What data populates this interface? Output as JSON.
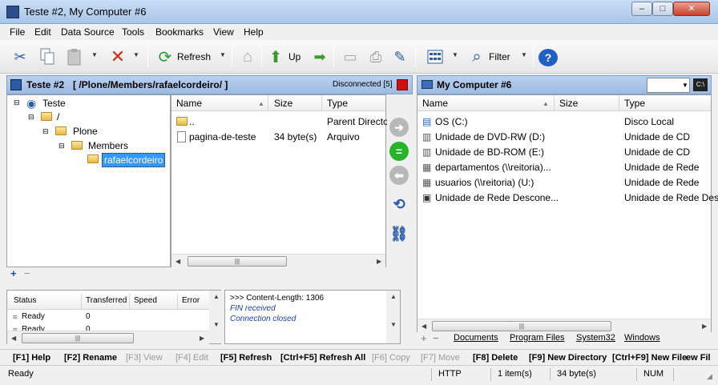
{
  "window": {
    "title": "Teste #2, My Computer #6",
    "min": "–",
    "max": "□",
    "close": "✕"
  },
  "menu": [
    "File",
    "Edit",
    "Data Source",
    "Tools",
    "Bookmarks",
    "View",
    "Help"
  ],
  "toolbar": {
    "refresh": "Refresh",
    "up": "Up",
    "filter": "Filter"
  },
  "left_panel": {
    "name": "Teste #2",
    "path": "[ /Plone/Members/rafaelcordeiro/ ]",
    "status": "Disconnected [5]",
    "tree": [
      "Teste",
      "/",
      "Plone",
      "Members",
      "rafaelcordeiro"
    ],
    "columns": [
      "Name",
      "Size",
      "Type"
    ],
    "files": [
      {
        "name": "..",
        "size": "",
        "type": "Parent Directo"
      },
      {
        "name": "pagina-de-teste",
        "size": "34 byte(s)",
        "type": "Arquivo"
      }
    ],
    "tree_add": "+",
    "tree_remove": "−"
  },
  "transfers": {
    "columns": [
      "Status",
      "Transferred",
      "Speed",
      "Error"
    ],
    "rows": [
      {
        "status": "Ready",
        "transferred": "0"
      },
      {
        "status": "Ready",
        "transferred": "0"
      }
    ]
  },
  "log": [
    "&gt;&gt;&gt; Content-Length: 1306",
    "FIN received",
    "Connection closed"
  ],
  "right_panel": {
    "name": "My Computer #6",
    "columns": [
      "Name",
      "Size",
      "Type"
    ],
    "files": [
      {
        "name": "OS (C:)",
        "type": "Disco Local"
      },
      {
        "name": "Unidade de DVD-RW (D:)",
        "type": "Unidade de CD"
      },
      {
        "name": "Unidade de BD-ROM (E:)",
        "type": "Unidade de CD"
      },
      {
        "name": "departamentos (\\\\reitoria)...",
        "type": "Unidade de Rede"
      },
      {
        "name": "usuarios (\\\\reitoria) (U:)",
        "type": "Unidade de Rede"
      },
      {
        "name": "Unidade de Rede Descone...",
        "type": "Unidade de Rede Des"
      }
    ],
    "tabs": [
      "Documents",
      "Program Files",
      "System32",
      "Windows"
    ],
    "tab_add": "+",
    "tab_remove": "−"
  },
  "fnkeys": [
    {
      "label": "[F1] Help",
      "enabled": true
    },
    {
      "label": "[F2] Rename",
      "enabled": true
    },
    {
      "label": "[F3] View",
      "enabled": false
    },
    {
      "label": "[F4] Edit",
      "enabled": false
    },
    {
      "label": "[F5] Refresh",
      "enabled": true
    },
    {
      "label": "[Ctrl+F5] Refresh All",
      "enabled": true
    },
    {
      "label": "[F6] Copy",
      "enabled": false
    },
    {
      "label": "[F7] Move",
      "enabled": false
    },
    {
      "label": "[F8] Delete",
      "enabled": true
    },
    {
      "label": "[F9] New Directory",
      "enabled": true
    },
    {
      "label": "[Ctrl+F9] New File",
      "enabled": true
    },
    {
      "label": "ew Fil",
      "enabled": true
    }
  ],
  "status": {
    "text": "Ready",
    "protocol": "HTTP",
    "items": "1 item(s)",
    "size": "34 byte(s)",
    "num": "NUM"
  }
}
